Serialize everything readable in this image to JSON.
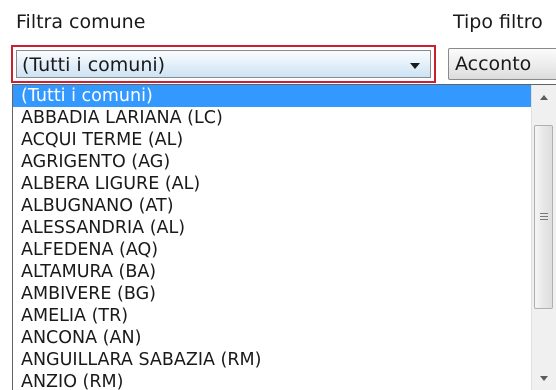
{
  "filter": {
    "label": "Filtra comune",
    "selected_value": "(Tutti i comuni)"
  },
  "type_filter": {
    "label": "Tipo filtro",
    "selected_value": "Acconto"
  },
  "dropdown": {
    "items": [
      "(Tutti i comuni)",
      "ABBADIA LARIANA (LC)",
      "ACQUI TERME (AL)",
      "AGRIGENTO (AG)",
      "ALBERA LIGURE (AL)",
      "ALBUGNANO (AT)",
      "ALESSANDRIA (AL)",
      "ALFEDENA (AQ)",
      "ALTAMURA (BA)",
      "AMBIVERE (BG)",
      "AMELIA (TR)",
      "ANCONA (AN)",
      "ANGUILLARA SABAZIA (RM)",
      "ANZIO (RM)"
    ],
    "highlighted_index": 0
  },
  "colors": {
    "focus_border": "#cc2030",
    "selection": "#3399ff"
  },
  "icons": {
    "dropdown_arrow": "chevron-down-icon",
    "scroll_up": "scroll-up-arrow-icon",
    "scroll_down": "scroll-down-arrow-icon"
  }
}
